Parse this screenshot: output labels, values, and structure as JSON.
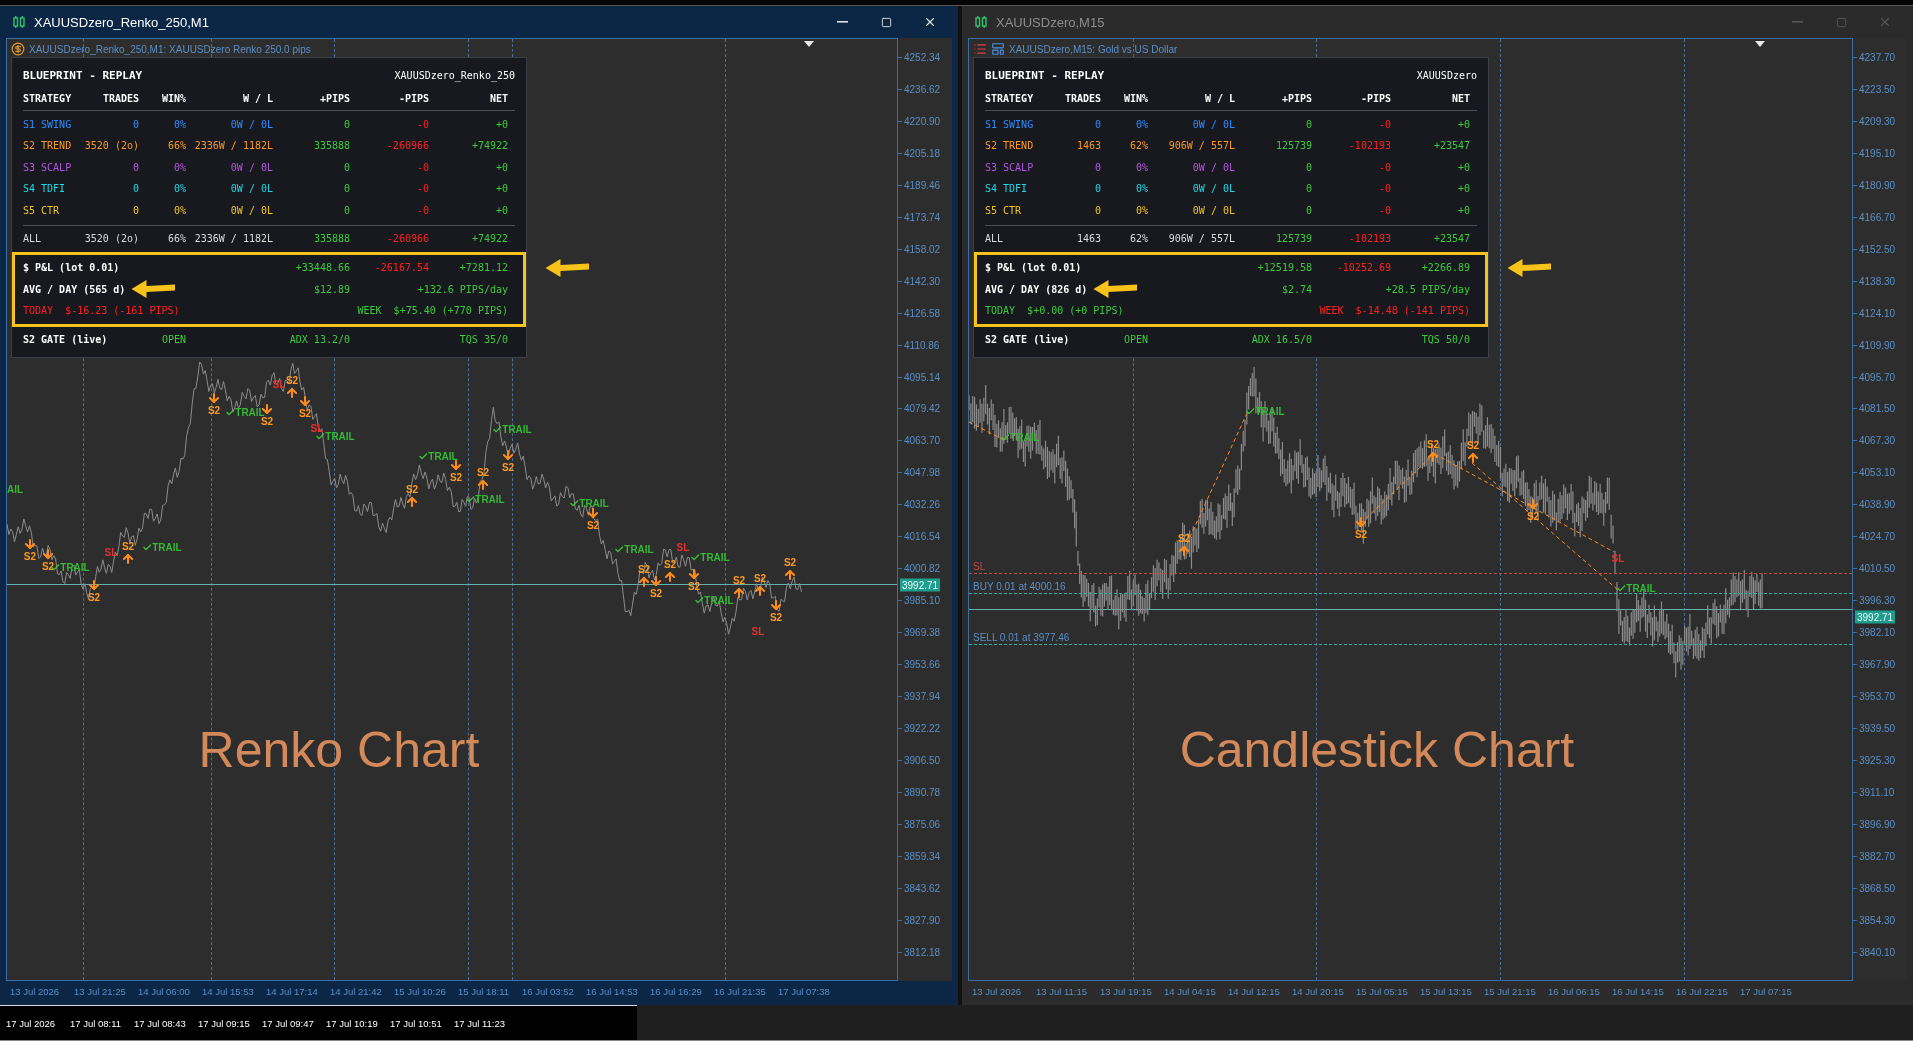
{
  "windows": [
    {
      "title": "XAUUSDzero_Renko_250,M1",
      "active": true,
      "kind": "renko",
      "subtitle": "XAUUSDzero_Renko_250,M1: XAUUSDzero Renko 250.0 pips",
      "caption": "Renko Chart",
      "panel": {
        "title": "BLUEPRINT - REPLAY",
        "symbol": "XAUUSDzero_Renko_250",
        "columns": [
          "STRATEGY",
          "TRADES",
          "WIN%",
          "W / L",
          "+PIPS",
          "-PIPS",
          "NET"
        ],
        "rows": [
          {
            "name": "S1 SWING",
            "color": "#2f8cff",
            "trades": "0",
            "win": "0%",
            "wl": "0W / 0L",
            "plus": "0",
            "minus": "-0",
            "net": "+0"
          },
          {
            "name": "S2 TREND",
            "color": "#ff9a1f",
            "trades": "3520 (2o)",
            "win": "66%",
            "wl": "2336W / 1182L",
            "plus": "335888",
            "minus": "-260966",
            "net": "+74922"
          },
          {
            "name": "S3 SCALP",
            "color": "#b455e0",
            "trades": "0",
            "win": "0%",
            "wl": "0W / 0L",
            "plus": "0",
            "minus": "-0",
            "net": "+0"
          },
          {
            "name": "S4 TDFI",
            "color": "#1ed8e8",
            "trades": "0",
            "win": "0%",
            "wl": "0W / 0L",
            "plus": "0",
            "minus": "-0",
            "net": "+0"
          },
          {
            "name": "S5 CTR",
            "color": "#f0c419",
            "trades": "0",
            "win": "0%",
            "wl": "0W / 0L",
            "plus": "0",
            "minus": "-0",
            "net": "+0"
          }
        ],
        "total": {
          "name": "ALL",
          "trades": "3520 (2o)",
          "win": "66%",
          "wl": "2336W / 1182L",
          "plus": "335888",
          "minus": "-260966",
          "net": "+74922"
        },
        "pnl": {
          "label": "$ P&L (lot 0.01)",
          "plus": "+33448.66",
          "minus": "-26167.54",
          "net": "+7281.12"
        },
        "avg": {
          "label": "AVG / DAY (565 d)",
          "amount": "$12.89",
          "pips": "+132.6 PIPS/day"
        },
        "today": {
          "label": "TODAY",
          "value": "$-16.23 (-161 PIPS)",
          "positive": false
        },
        "week": {
          "label": "WEEK",
          "value": "$+75.40 (+770 PIPS)",
          "positive": true
        },
        "gate": {
          "label": "S2 GATE (live)",
          "status": "OPEN",
          "adx": "ADX 13.2/0",
          "tqs": "TQS 35/0"
        }
      },
      "price_axis": [
        "4252.34",
        "4236.62",
        "4220.90",
        "4205.18",
        "4189.46",
        "4173.74",
        "4158.02",
        "4142.30",
        "4126.58",
        "4110.86",
        "4095.14",
        "4079.42",
        "4063.70",
        "4047.98",
        "4032.26",
        "4016.54",
        "4000.82",
        "3985.10",
        "3969.38",
        "3953.66",
        "3937.94",
        "3922.22",
        "3906.50",
        "3890.78",
        "3875.06",
        "3859.34",
        "3843.62",
        "3827.90",
        "3812.18"
      ],
      "current_price": "3992.71",
      "time_axis": [
        "13 Jul 2026",
        "13 Jul 21:25",
        "14 Jul 06:00",
        "14 Jul 15:53",
        "14 Jul 17:14",
        "14 Jul 21:42",
        "15 Jul 10:26",
        "15 Jul 18:11",
        "16 Jul 03:52",
        "16 Jul 14:53",
        "16 Jul 16:29",
        "16 Jul 21:35",
        "17 Jul 07:38"
      ],
      "markers": [
        {
          "kind": "cut",
          "label": "AIL"
        },
        {
          "kind": "sell",
          "label": "S2"
        },
        {
          "kind": "sell",
          "label": "S2"
        },
        {
          "kind": "exit",
          "label": "TRAIL"
        },
        {
          "kind": "sell",
          "label": "S2"
        },
        {
          "kind": "stop",
          "label": "SL"
        },
        {
          "kind": "buy",
          "label": "S2"
        },
        {
          "kind": "exit",
          "label": "TRAIL"
        },
        {
          "kind": "sell",
          "label": "S2"
        },
        {
          "kind": "exit",
          "label": "TRAIL"
        },
        {
          "kind": "sell",
          "label": "S2"
        },
        {
          "kind": "stop",
          "label": "SL"
        },
        {
          "kind": "buy",
          "label": "S2"
        },
        {
          "kind": "sell",
          "label": "S2"
        },
        {
          "kind": "stop",
          "label": "SL"
        },
        {
          "kind": "exit",
          "label": "TRAIL"
        },
        {
          "kind": "exit",
          "label": "TRAIL"
        },
        {
          "kind": "buy",
          "label": "S2"
        },
        {
          "kind": "sell",
          "label": "S2"
        },
        {
          "kind": "buy",
          "label": "S2"
        },
        {
          "kind": "exit",
          "label": "TRAIL"
        },
        {
          "kind": "sell",
          "label": "S2"
        },
        {
          "kind": "exit",
          "label": "TRAIL"
        },
        {
          "kind": "exit",
          "label": "TRAIL"
        },
        {
          "kind": "sell",
          "label": "S2"
        },
        {
          "kind": "exit",
          "label": "TRAIL"
        },
        {
          "kind": "buy",
          "label": "S2"
        },
        {
          "kind": "sell",
          "label": "S2"
        },
        {
          "kind": "buy",
          "label": "S2"
        },
        {
          "kind": "stop",
          "label": "SL"
        },
        {
          "kind": "exit",
          "label": "TRAIL"
        },
        {
          "kind": "sell",
          "label": "S2"
        },
        {
          "kind": "exit",
          "label": "TRAIL"
        },
        {
          "kind": "buy",
          "label": "S2"
        },
        {
          "kind": "buy",
          "label": "S2"
        },
        {
          "kind": "stop",
          "label": "SL"
        },
        {
          "kind": "sell",
          "label": "S2"
        },
        {
          "kind": "buy",
          "label": "S2"
        }
      ]
    },
    {
      "title": "XAUUSDzero,M15",
      "active": false,
      "kind": "candles",
      "subtitle": "XAUUSDzero,M15:  Gold vs US Dollar",
      "caption": "Candlestick Chart",
      "panel": {
        "title": "BLUEPRINT - REPLAY",
        "symbol": "XAUUSDzero",
        "columns": [
          "STRATEGY",
          "TRADES",
          "WIN%",
          "W / L",
          "+PIPS",
          "-PIPS",
          "NET"
        ],
        "rows": [
          {
            "name": "S1 SWING",
            "color": "#2f8cff",
            "trades": "0",
            "win": "0%",
            "wl": "0W / 0L",
            "plus": "0",
            "minus": "-0",
            "net": "+0"
          },
          {
            "name": "S2 TREND",
            "color": "#ff9a1f",
            "trades": "1463",
            "win": "62%",
            "wl": "906W / 557L",
            "plus": "125739",
            "minus": "-102193",
            "net": "+23547"
          },
          {
            "name": "S3 SCALP",
            "color": "#b455e0",
            "trades": "0",
            "win": "0%",
            "wl": "0W / 0L",
            "plus": "0",
            "minus": "-0",
            "net": "+0"
          },
          {
            "name": "S4 TDFI",
            "color": "#1ed8e8",
            "trades": "0",
            "win": "0%",
            "wl": "0W / 0L",
            "plus": "0",
            "minus": "-0",
            "net": "+0"
          },
          {
            "name": "S5 CTR",
            "color": "#f0c419",
            "trades": "0",
            "win": "0%",
            "wl": "0W / 0L",
            "plus": "0",
            "minus": "-0",
            "net": "+0"
          }
        ],
        "total": {
          "name": "ALL",
          "trades": "1463",
          "win": "62%",
          "wl": "906W / 557L",
          "plus": "125739",
          "minus": "-102193",
          "net": "+23547"
        },
        "pnl": {
          "label": "$ P&L (lot 0.01)",
          "plus": "+12519.58",
          "minus": "-10252.69",
          "net": "+2266.89"
        },
        "avg": {
          "label": "AVG / DAY (826 d)",
          "amount": "$2.74",
          "pips": "+28.5 PIPS/day"
        },
        "today": {
          "label": "TODAY",
          "value": "$+0.00 (+0 PIPS)",
          "positive": true
        },
        "week": {
          "label": "WEEK",
          "value": "$-14.48 (-141 PIPS)",
          "positive": false
        },
        "gate": {
          "label": "S2 GATE (live)",
          "status": "OPEN",
          "adx": "ADX 16.5/0",
          "tqs": "TQS 50/0"
        }
      },
      "price_axis": [
        "4237.70",
        "4223.50",
        "4209.30",
        "4195.10",
        "4180.90",
        "4166.70",
        "4152.50",
        "4138.30",
        "4124.10",
        "4109.90",
        "4095.70",
        "4081.50",
        "4067.30",
        "4053.10",
        "4038.90",
        "4024.70",
        "4010.50",
        "3996.30",
        "3982.10",
        "3967.90",
        "3953.70",
        "3939.50",
        "3925.30",
        "3911.10",
        "3896.90",
        "3882.70",
        "3868.50",
        "3854.30",
        "3840.10"
      ],
      "current_price": "3992.71",
      "time_axis": [
        "13 Jul 2026",
        "13 Jul 11:15",
        "13 Jul 19:15",
        "14 Jul 04:15",
        "14 Jul 12:15",
        "14 Jul 20:15",
        "15 Jul 05:15",
        "15 Jul 13:15",
        "15 Jul 21:15",
        "16 Jul 06:15",
        "16 Jul 14:15",
        "16 Jul 22:15",
        "17 Jul 07:15"
      ],
      "markers": [
        {
          "kind": "exit",
          "label": "TRAIL"
        },
        {
          "kind": "exit",
          "label": "TRAIL"
        },
        {
          "kind": "buy",
          "label": "S2"
        },
        {
          "kind": "sell",
          "label": "S2"
        },
        {
          "kind": "buy",
          "label": "S2"
        },
        {
          "kind": "buy",
          "label": "S2"
        },
        {
          "kind": "sell",
          "label": "S2"
        },
        {
          "kind": "stop",
          "label": "SL"
        },
        {
          "kind": "exit",
          "label": "TRAIL"
        }
      ],
      "order_lines": [
        {
          "kind": "stop",
          "label": "SL"
        },
        {
          "kind": "buy",
          "label": "BUY 0.01 at 4000.16"
        },
        {
          "kind": "sell",
          "label": "SELL 0.01 at 3977.46"
        }
      ]
    }
  ],
  "bottom_time_axis": [
    "17 Jul 2026",
    "17 Jul 08:11",
    "17 Jul 08:43",
    "17 Jul 09:15",
    "17 Jul 09:47",
    "17 Jul 10:19",
    "17 Jul 10:51",
    "17 Jul 11:23"
  ]
}
